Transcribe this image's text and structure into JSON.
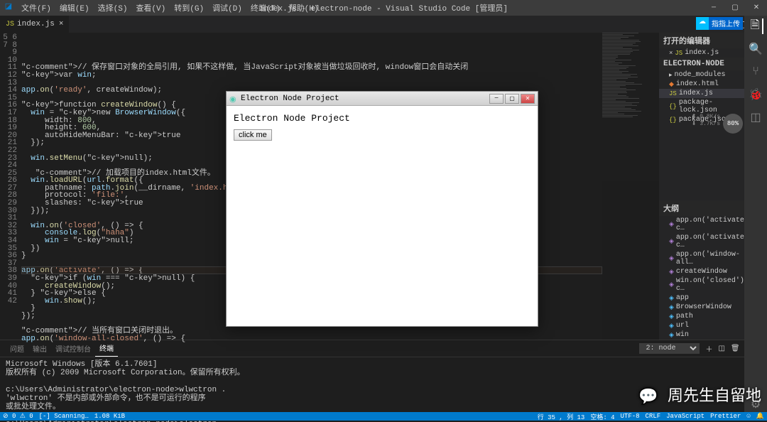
{
  "window": {
    "title": "index.js - electron-node - Visual Studio Code [管理员]"
  },
  "menu": {
    "file": "文件(F)",
    "edit": "编辑(E)",
    "select": "选择(S)",
    "view": "查看(V)",
    "goto": "转到(G)",
    "debug": "调试(D)",
    "terminal": "终端(T)",
    "help": "帮助(H)"
  },
  "tab": {
    "name": "index.js"
  },
  "cloud": {
    "a": "☁",
    "b": "指指上传"
  },
  "code": {
    "lines": [
      {
        "n": "5",
        "t": ""
      },
      {
        "n": "6",
        "t": "// 保存窗口对象的全局引用, 如果不这样做, 当JavaScript对象被当做垃圾回收时, window窗口会自动关闭"
      },
      {
        "n": "7",
        "t": "var win;"
      },
      {
        "n": "8",
        "t": ""
      },
      {
        "n": "9",
        "t": "app.on('ready', createWindow);"
      },
      {
        "n": "10",
        "t": ""
      },
      {
        "n": "11",
        "t": "function createWindow() {"
      },
      {
        "n": "12",
        "t": "  win = new BrowserWindow({"
      },
      {
        "n": "13",
        "t": "     width: 800,"
      },
      {
        "n": "14",
        "t": "     height: 600,"
      },
      {
        "n": "15",
        "t": "     autoHideMenuBar: true"
      },
      {
        "n": "16",
        "t": "  });"
      },
      {
        "n": "17",
        "t": ""
      },
      {
        "n": "18",
        "t": "  win.setMenu(null);"
      },
      {
        "n": "19",
        "t": ""
      },
      {
        "n": "20",
        "t": "   // 加载项目的index.html文件。"
      },
      {
        "n": "21",
        "t": "  win.loadURL(url.format({"
      },
      {
        "n": "22",
        "t": "     pathname: path.join(__dirname, 'index.html'),"
      },
      {
        "n": "23",
        "t": "     protocol: 'file:',"
      },
      {
        "n": "24",
        "t": "     slashes: true"
      },
      {
        "n": "25",
        "t": "  }));"
      },
      {
        "n": "26",
        "t": ""
      },
      {
        "n": "27",
        "t": "  win.on('closed', () => {"
      },
      {
        "n": "28",
        "t": "     console.log(\"haha\")"
      },
      {
        "n": "29",
        "t": "     win = null;"
      },
      {
        "n": "30",
        "t": "  })"
      },
      {
        "n": "31",
        "t": "}"
      },
      {
        "n": "32",
        "t": ""
      },
      {
        "n": "33",
        "t": "app.on('activate', () => {"
      },
      {
        "n": "34",
        "t": "  if (win === null) {"
      },
      {
        "n": "35",
        "t": "     createWindow();"
      },
      {
        "n": "36",
        "t": "  } else {"
      },
      {
        "n": "37",
        "t": "     win.show();"
      },
      {
        "n": "38",
        "t": "  }"
      },
      {
        "n": "39",
        "t": "});"
      },
      {
        "n": "40",
        "t": ""
      },
      {
        "n": "41",
        "t": "// 当所有窗口关闭时退出。"
      },
      {
        "n": "42",
        "t": "app.on('window-all-closed', () => {"
      }
    ]
  },
  "explorer": {
    "header_open": "打开的编辑器",
    "open_file": "index.js",
    "project": "ELECTRON-NODE",
    "files": {
      "node_modules": "node_modules",
      "index_html": "index.html",
      "index_js": "index.js",
      "pkg_lock": "package-lock.json",
      "pkg": "package.json"
    }
  },
  "outline": {
    "header": "大纲",
    "items": [
      "app.on('activate') c…",
      "app.on('activate') c…",
      "app.on('window-all…",
      "createWindow",
      "win.on('closed') c…",
      "app",
      "BrowserWindow",
      "path",
      "url",
      "win"
    ]
  },
  "panel": {
    "tabs": {
      "problems": "问题",
      "output": "输出",
      "debug": "调试控制台",
      "terminal": "终端"
    },
    "select": "2: node",
    "terminal": "Microsoft Windows [版本 6.1.7601]\n版权所有 (c) 2009 Microsoft Corporation。保留所有权利。\n\nc:\\Users\\Administrator\\electron-node>wlwctron .\n'wlwctron' 不是内部或外部命令，也不是可运行的程序\n或批处理文件。\n\nc:\\Users\\Administrator\\electron-node>electron .\n□"
  },
  "status": {
    "errors": "⊘ 0  ⚠ 0",
    "scanning": "[-] Scanning…",
    "size": "1.08 KiB",
    "lncol": "行 35 , 列 13",
    "spaces": "空格: 4",
    "enc": "UTF-8",
    "eol": "CRLF",
    "lang": "JavaScript",
    "prettier": "Prettier",
    "smile": "☺",
    "bell": "🔔"
  },
  "electron": {
    "title": "Electron Node Project",
    "body_title": "Electron Node Project",
    "button": "click me"
  },
  "perf": {
    "line1": "⬆ 0.8K/s",
    "line2": "⬇ 3.7K/s",
    "pct": "80%"
  },
  "watermark": "周先生自留地"
}
